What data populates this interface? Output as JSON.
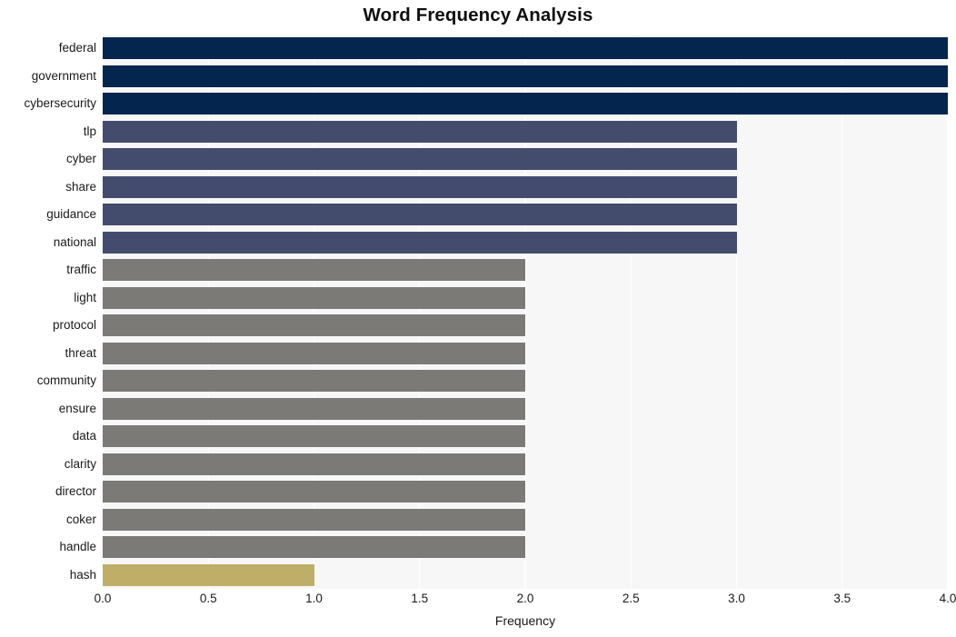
{
  "chart_data": {
    "type": "bar",
    "orientation": "horizontal",
    "title": "Word Frequency Analysis",
    "xlabel": "Frequency",
    "ylabel": "",
    "categories": [
      "federal",
      "government",
      "cybersecurity",
      "tlp",
      "cyber",
      "share",
      "guidance",
      "national",
      "traffic",
      "light",
      "protocol",
      "threat",
      "community",
      "ensure",
      "data",
      "clarity",
      "director",
      "coker",
      "handle",
      "hash"
    ],
    "values": [
      4,
      4,
      4,
      3,
      3,
      3,
      3,
      3,
      2,
      2,
      2,
      2,
      2,
      2,
      2,
      2,
      2,
      2,
      2,
      1
    ],
    "bar_colors": [
      "#04254e",
      "#04254e",
      "#04254e",
      "#444c6e",
      "#444c6e",
      "#444c6e",
      "#444c6e",
      "#444c6e",
      "#7b7a77",
      "#7b7a77",
      "#7b7a77",
      "#7b7a77",
      "#7b7a77",
      "#7b7a77",
      "#7b7a77",
      "#7b7a77",
      "#7b7a77",
      "#7b7a77",
      "#7b7a77",
      "#bfae67"
    ],
    "xlim": [
      0.0,
      4.0
    ],
    "ylim_categories": 20,
    "xticks": [
      0.0,
      0.5,
      1.0,
      1.5,
      2.0,
      2.5,
      3.0,
      3.5,
      4.0
    ],
    "xtick_labels": [
      "0.0",
      "0.5",
      "1.0",
      "1.5",
      "2.0",
      "2.5",
      "3.0",
      "3.5",
      "4.0"
    ],
    "grid": {
      "vertical": true,
      "horizontal": false,
      "color": "#ffffff"
    },
    "legend": null,
    "plot_background": "#f7f7f7",
    "figure_background": "#ffffff",
    "title_color": "#101010",
    "tick_label_color": "#1a1a1a"
  }
}
